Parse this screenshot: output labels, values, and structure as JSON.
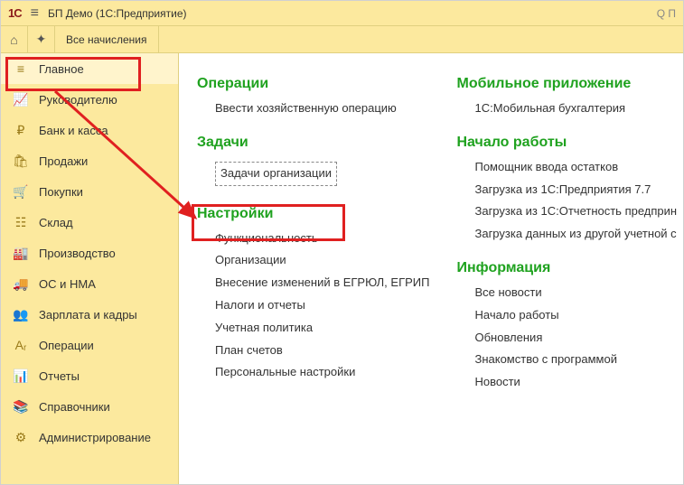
{
  "title": {
    "logo": "1С",
    "text": "БП Демо  (1С:Предприятие)",
    "right": "Q П"
  },
  "toolbar": {
    "tab_label": "Все начисления"
  },
  "sidebar": {
    "items": [
      {
        "label": "Главное",
        "icon_name": "menu-icon"
      },
      {
        "label": "Руководителю",
        "icon_name": "chart-icon"
      },
      {
        "label": "Банк и касса",
        "icon_name": "ruble-icon"
      },
      {
        "label": "Продажи",
        "icon_name": "bag-icon"
      },
      {
        "label": "Покупки",
        "icon_name": "cart-icon"
      },
      {
        "label": "Склад",
        "icon_name": "boxes-icon"
      },
      {
        "label": "Производство",
        "icon_name": "factory-icon"
      },
      {
        "label": "ОС и НМА",
        "icon_name": "truck-icon"
      },
      {
        "label": "Зарплата и кадры",
        "icon_name": "people-icon"
      },
      {
        "label": "Операции",
        "icon_name": "operations-icon"
      },
      {
        "label": "Отчеты",
        "icon_name": "report-icon"
      },
      {
        "label": "Справочники",
        "icon_name": "books-icon"
      },
      {
        "label": "Администрирование",
        "icon_name": "gear-icon"
      }
    ]
  },
  "sections": {
    "col1": [
      {
        "title": "Операции",
        "links": [
          {
            "label": "Ввести хозяйственную операцию"
          }
        ]
      },
      {
        "title": "Задачи",
        "links": [
          {
            "label": "Задачи организации",
            "dashed": true
          }
        ]
      },
      {
        "title": "Настройки",
        "links": [
          {
            "label": "Функциональность"
          },
          {
            "label": "Организации"
          },
          {
            "label": "Внесение изменений в ЕГРЮЛ, ЕГРИП"
          },
          {
            "label": "Налоги и отчеты"
          },
          {
            "label": "Учетная политика"
          },
          {
            "label": "План счетов"
          },
          {
            "label": "Персональные настройки"
          }
        ]
      }
    ],
    "col2": [
      {
        "title": "Мобильное приложение",
        "links": [
          {
            "label": "1С:Мобильная бухгалтерия"
          }
        ]
      },
      {
        "title": "Начало работы",
        "links": [
          {
            "label": "Помощник ввода остатков"
          },
          {
            "label": "Загрузка из 1С:Предприятия 7.7"
          },
          {
            "label": "Загрузка из 1С:Отчетность предприн"
          },
          {
            "label": "Загрузка данных из другой учетной с"
          }
        ]
      },
      {
        "title": "Информация",
        "links": [
          {
            "label": "Все новости"
          },
          {
            "label": "Начало работы"
          },
          {
            "label": "Обновления"
          },
          {
            "label": "Знакомство с программой"
          },
          {
            "label": "Новости"
          }
        ]
      }
    ]
  }
}
